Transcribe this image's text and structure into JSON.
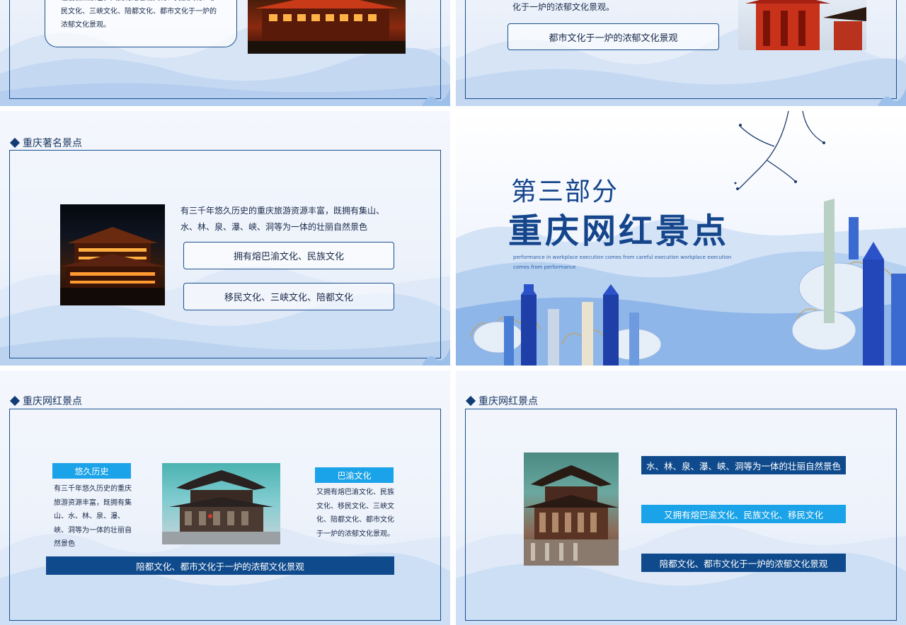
{
  "slide1": {
    "box_text": "壮丽自然景色，又拥有熔巴渝文化、民族文化、移民文化、三峡文化、陪都文化、都市文化于一炉的浓郁文化景观。"
  },
  "slide2": {
    "text": "化于一炉的浓郁文化景观。",
    "pill": "都市文化于一炉的浓郁文化景观"
  },
  "slide3": {
    "title": "重庆著名景点",
    "text": "有三千年悠久历史的重庆旅游资源丰富，既拥有集山、水、林、泉、瀑、峡、洞等为一体的壮丽自然景色",
    "pill1": "拥有熔巴渝文化、民族文化",
    "pill2": "移民文化、三峡文化、陪都文化"
  },
  "slide4": {
    "subtitle": "第三部分",
    "title": "重庆网红景点",
    "english": "performance in workplace execution comes from careful execution workplace execution comes from performance"
  },
  "slide5": {
    "title": "重庆网红景点",
    "tag_left": "悠久历史",
    "text_left": "有三千年悠久历史的重庆旅游资源丰富，既拥有集山、水、林、泉、瀑、峡、洞等为一体的壮丽自然景色",
    "tag_right": "巴渝文化",
    "text_right": "又拥有熔巴渝文化、民族文化、移民文化、三峡文化、陪都文化、都市文化于一炉的浓郁文化景观。",
    "bottom_bar": "陪都文化、都市文化于一炉的浓郁文化景观"
  },
  "slide6": {
    "title": "重庆网红景点",
    "bar1": "水、林、泉、瀑、峡、洞等为一体的壮丽自然景色",
    "bar2": "又拥有熔巴渝文化、民族文化、移民文化",
    "bar3": "陪都文化、都市文化于一炉的浓郁文化景观"
  },
  "colors": {
    "navy": "#123d74",
    "frame": "#1b4f8f",
    "cyan": "#1aa3e8",
    "bar_dark": "#0f4a8c"
  }
}
